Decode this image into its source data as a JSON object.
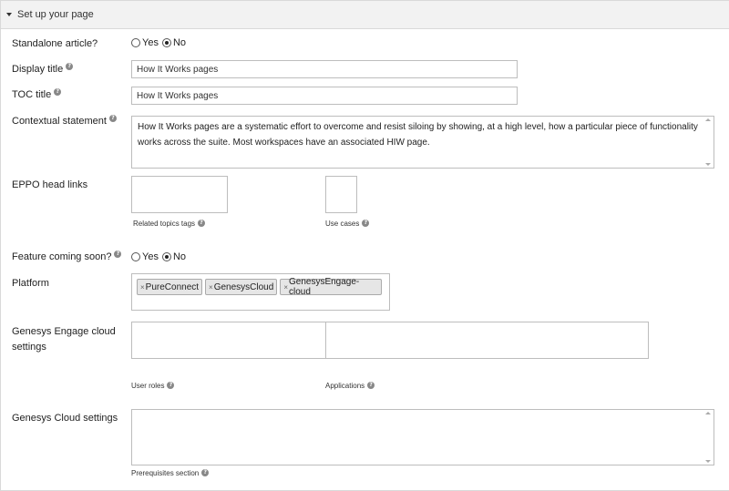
{
  "section": {
    "title": "Set up your page"
  },
  "standalone": {
    "label": "Standalone article?",
    "yes": "Yes",
    "no": "No",
    "selected": "No"
  },
  "display_title": {
    "label": "Display title",
    "value": "How It Works pages"
  },
  "toc_title": {
    "label": "TOC title",
    "value": "How It Works pages"
  },
  "contextual": {
    "label": "Contextual statement",
    "value": "How It Works pages are a systematic effort to overcome and resist siloing by showing, at a high level, how a particular piece of functionality works across the suite. Most workspaces have an associated HIW page."
  },
  "eppo": {
    "label": "EPPO head links",
    "related_caption": "Related topics tags",
    "usecases_caption": "Use cases"
  },
  "feature": {
    "label": "Feature coming soon?",
    "yes": "Yes",
    "no": "No",
    "selected": "No"
  },
  "platform": {
    "label": "Platform",
    "tags": [
      "PureConnect",
      "GenesysCloud",
      "GenesysEngage-cloud"
    ]
  },
  "engage_cloud": {
    "label_line1": "Genesys Engage cloud",
    "label_line2": "settings",
    "roles_caption": "User roles",
    "apps_caption": "Applications"
  },
  "genesys_cloud": {
    "label": "Genesys Cloud settings",
    "prereq_caption": "Prerequisites section"
  },
  "icons": {
    "help": "question-circle-icon",
    "collapse": "caret-down-icon",
    "remove": "x-icon"
  }
}
